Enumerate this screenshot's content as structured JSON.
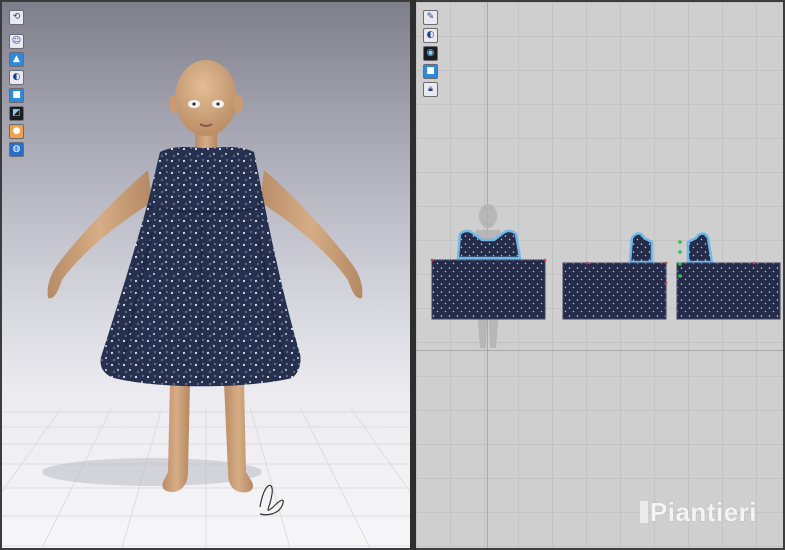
{
  "window": {
    "panes": [
      {
        "name": "3D Garment"
      },
      {
        "name": "2D Pattern"
      }
    ]
  },
  "toolbar_3d": {
    "tools": [
      {
        "icon": "rotate-view-icon"
      },
      {
        "icon": "avatar-display-icon"
      },
      {
        "icon": "garment-display-icon"
      },
      {
        "icon": "texture-icon"
      },
      {
        "icon": "fabric-render-icon"
      },
      {
        "icon": "pattern-display-icon"
      },
      {
        "icon": "avatar-skin-icon"
      },
      {
        "icon": "environment-icon"
      }
    ]
  },
  "toolbar_2d": {
    "tools": [
      {
        "icon": "pen-tool-icon"
      },
      {
        "icon": "texture-2d-icon"
      },
      {
        "icon": "fabric-2d-icon"
      },
      {
        "icon": "pattern-color-icon"
      },
      {
        "icon": "lock-icon"
      }
    ]
  },
  "colors": {
    "fabric": "#2a3050",
    "skin": "#c9a07a",
    "pattern_outline": "#6fb8e8",
    "pattern_fill": "#252c4a"
  },
  "watermark": {
    "text": "Piantieri"
  }
}
